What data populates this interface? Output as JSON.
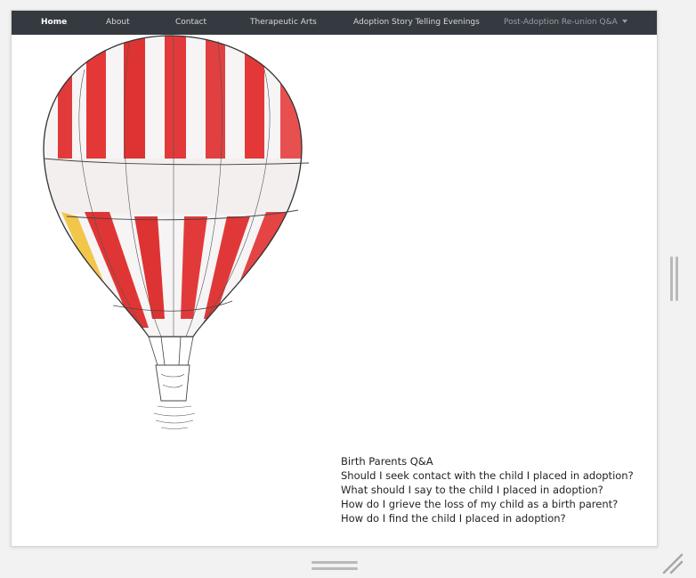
{
  "nav": {
    "items": [
      {
        "label": "Home",
        "active": true
      },
      {
        "label": "About"
      },
      {
        "label": "Contact"
      },
      {
        "label": "Therapeutic Arts"
      },
      {
        "label": "Adoption Story Telling Evenings"
      },
      {
        "label": "Post-Adoption Re-union Q&A",
        "dropdown": true
      }
    ]
  },
  "hero": {
    "image": "hot-air-balloon-illustration"
  },
  "qa": {
    "heading": "Birth Parents Q&A",
    "questions": [
      "Should I seek contact with the child I placed in adoption?",
      "What should I say to the child I placed in adoption?",
      "How do I grieve the loss of my child as a birth parent?",
      "How do I find the child I placed in adoption?"
    ]
  },
  "colors": {
    "navbar": "#343a40",
    "balloon_red": "#e23a3a",
    "text": "#222222"
  }
}
